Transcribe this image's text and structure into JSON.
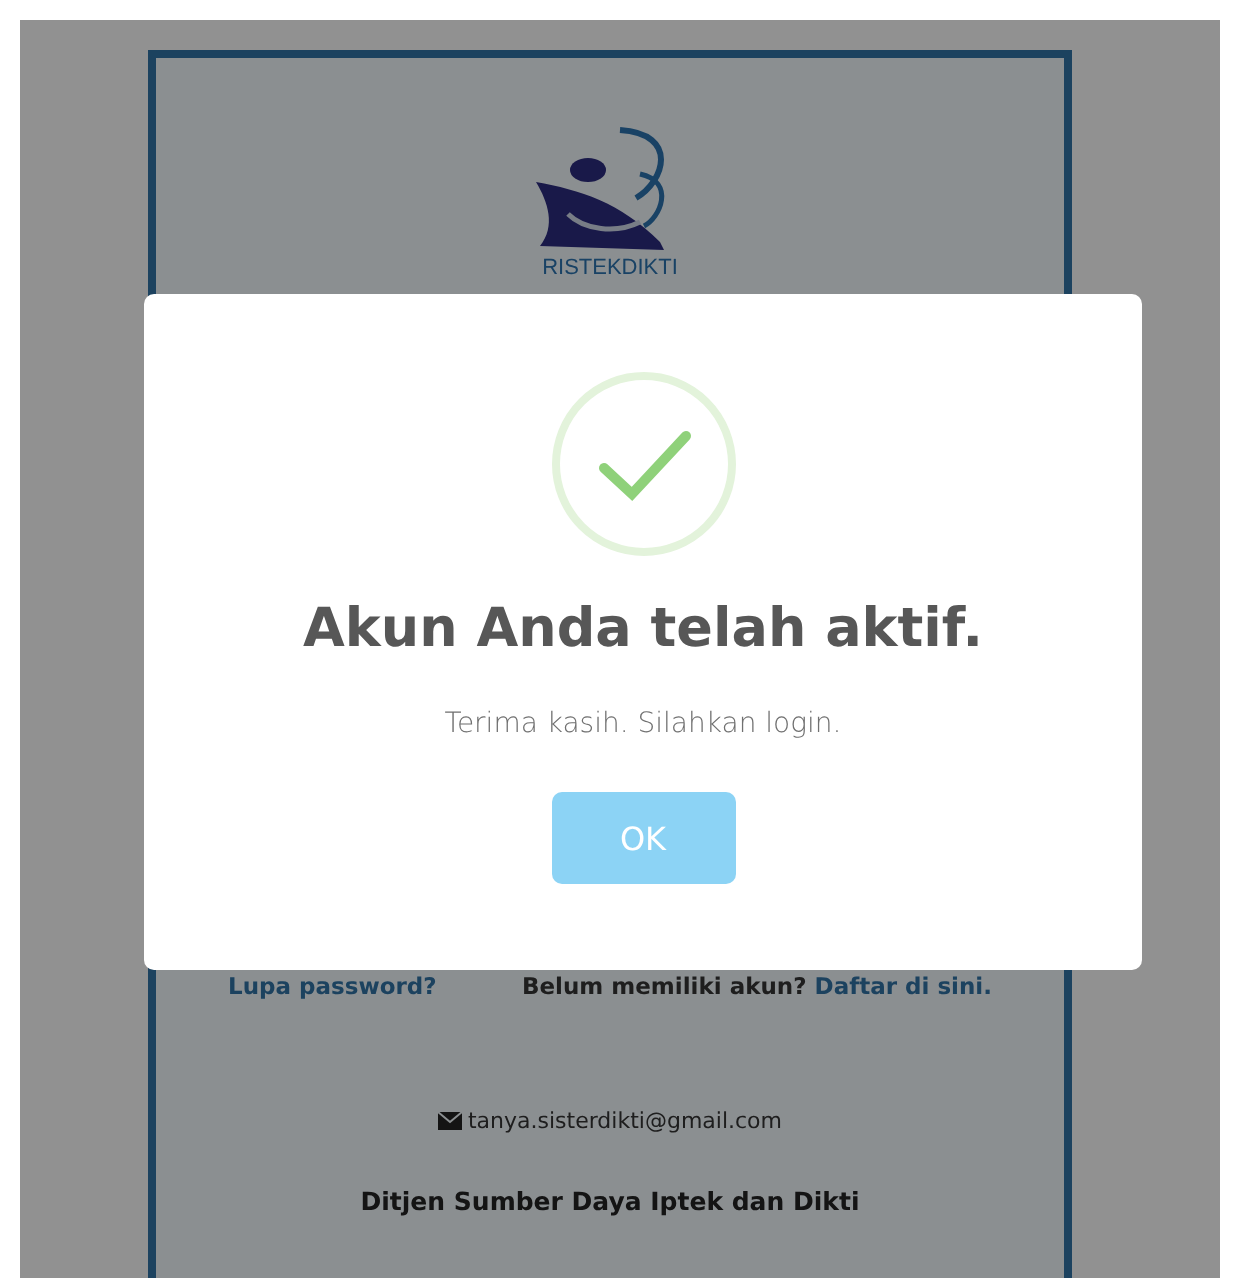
{
  "logo": {
    "text": "RISTEKDIKTI"
  },
  "links": {
    "forgot": "Lupa password?",
    "signup_prompt": "Belum memiliki akun?",
    "signup_link": "Daftar di sini."
  },
  "contact": {
    "email": "tanya.sisterdikti@gmail.com"
  },
  "footer": "Ditjen Sumber Daya Iptek dan Dikti",
  "dialog": {
    "kind": "success",
    "title": "Akun Anda telah aktif.",
    "message": "Terima kasih. Silahkan login.",
    "button": "OK"
  }
}
